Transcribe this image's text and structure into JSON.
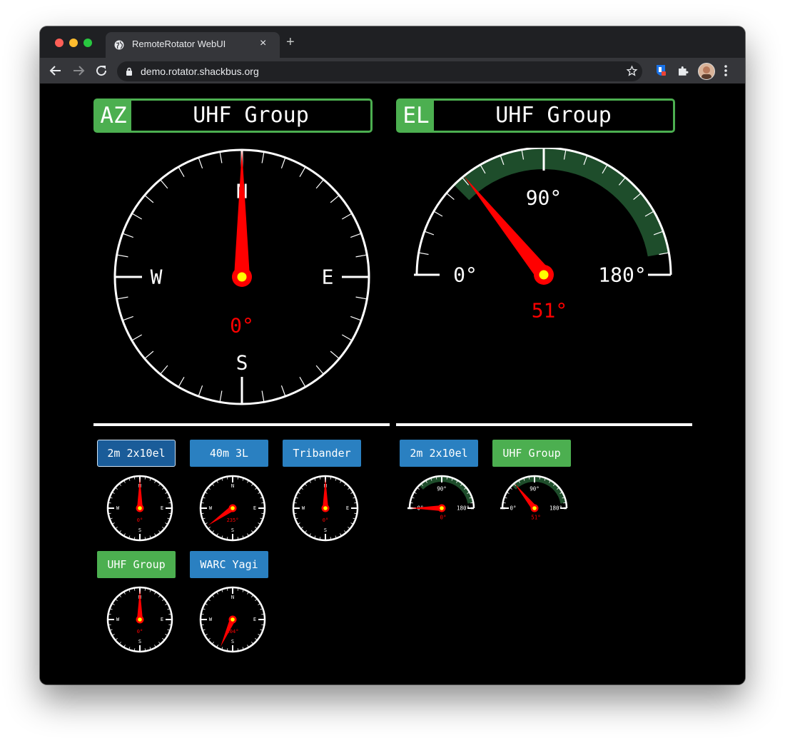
{
  "browser": {
    "tab_title": "RemoteRotator WebUI",
    "tab_close": "×",
    "new_tab": "+",
    "url": "demo.rotator.shackbus.org"
  },
  "az_panel": {
    "tag": "AZ",
    "name": "UHF Group"
  },
  "el_panel": {
    "tag": "EL",
    "name": "UHF Group"
  },
  "az_big": {
    "heading": "0°",
    "labels": {
      "n": "N",
      "e": "E",
      "s": "S",
      "w": "W"
    },
    "heading_deg": 0
  },
  "el_big": {
    "reading": "51°",
    "elevation_deg": 51,
    "scale": {
      "min": "0°",
      "mid": "90°",
      "max": "180°"
    }
  },
  "az_rotators": [
    {
      "label": "2m 2x10el",
      "heading": "0°",
      "heading_deg": 0,
      "state": "selected"
    },
    {
      "label": "40m 3L",
      "heading": "235°",
      "heading_deg": 235,
      "state": "normal"
    },
    {
      "label": "Tribander",
      "heading": "0°",
      "heading_deg": 0,
      "state": "normal"
    },
    {
      "label": "UHF Group",
      "heading": "0°",
      "heading_deg": 0,
      "state": "active"
    },
    {
      "label": "WARC Yagi",
      "heading": "204°",
      "heading_deg": 204,
      "state": "normal"
    }
  ],
  "el_rotators": [
    {
      "label": "2m 2x10el",
      "reading": "0°",
      "elevation_deg": 0,
      "state": "normal"
    },
    {
      "label": "UHF Group",
      "reading": "51°",
      "elevation_deg": 51,
      "state": "active"
    }
  ],
  "colors": {
    "active_green": "#4caf50",
    "button_blue": "#2a80c1",
    "needle_red": "#ff0000",
    "hub_yellow": "#ffff00",
    "arc_green": "#1e4d2b"
  }
}
